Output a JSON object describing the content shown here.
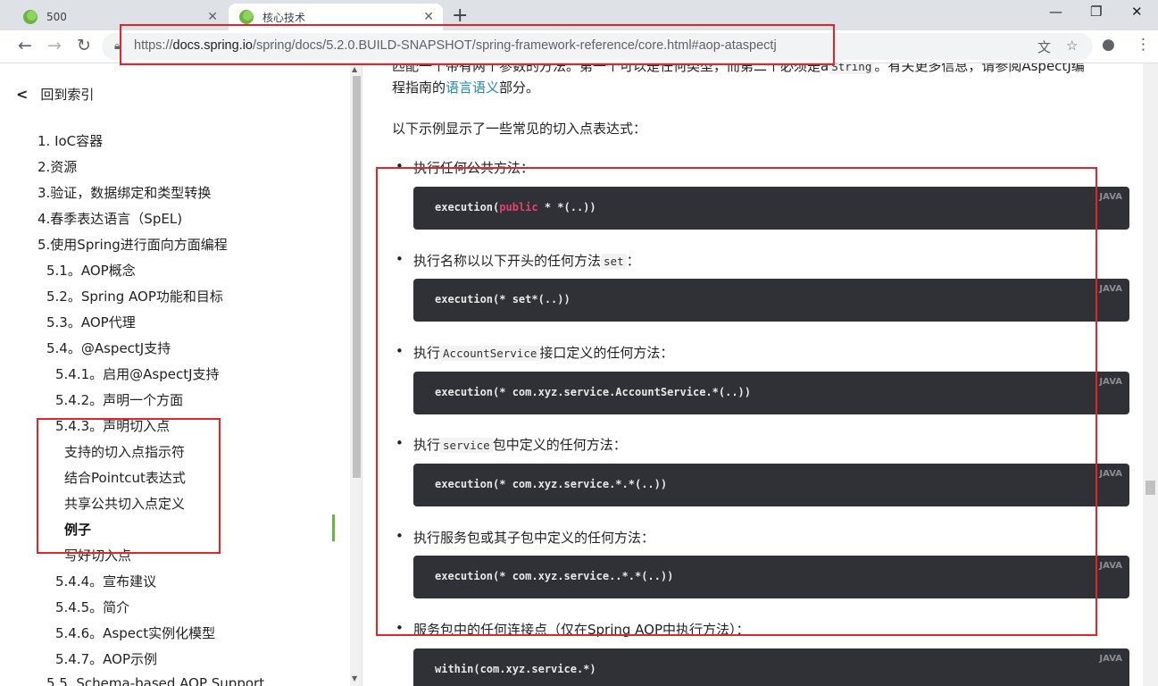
{
  "browser": {
    "tabs": [
      {
        "title": "500",
        "active": false
      },
      {
        "title": "核心技术",
        "active": true
      }
    ],
    "new_tab": "+",
    "window_controls": {
      "minimize": "—",
      "restore": "❐",
      "close": "✕"
    },
    "url_base": "https://",
    "url_host": "docs.spring.io",
    "url_path": "/spring/docs/5.2.0.BUILD-SNAPSHOT/spring-framework-reference/core.html#aop-ataspectj",
    "icons": [
      "back-icon",
      "forward-icon",
      "reload-icon",
      "lock-icon",
      "translate-icon",
      "star-icon",
      "account-icon",
      "menu-icon"
    ]
  },
  "sidebar": {
    "back_label": "回到索引",
    "items": [
      {
        "label": "1. IoC容器"
      },
      {
        "label": "2.资源"
      },
      {
        "label": "3.验证，数据绑定和类型转换"
      },
      {
        "label": "4.春季表达语言（SpEL)"
      },
      {
        "label": "5.使用Spring进行面向方面编程"
      },
      {
        "label": "5.1。AOP概念"
      },
      {
        "label": "5.2。Spring AOP功能和目标"
      },
      {
        "label": "5.3。AOP代理"
      },
      {
        "label": "5.4。@AspectJ支持"
      },
      {
        "label": "5.4.1。启用@AspectJ支持"
      },
      {
        "label": "5.4.2。声明一个方面"
      },
      {
        "label": "5.4.3。声明切入点"
      },
      {
        "label": "支持的切入点指示符"
      },
      {
        "label": "结合Pointcut表达式"
      },
      {
        "label": "共享公共切入点定义"
      },
      {
        "label": "例子"
      },
      {
        "label": "写好切入点"
      },
      {
        "label": "5.4.4。宣布建议"
      },
      {
        "label": "5.4.5。简介"
      },
      {
        "label": "5.4.6。Aspect实例化模型"
      },
      {
        "label": "5.4.7。AOP示例"
      },
      {
        "label": "5.5. Schema-based AOP Support"
      }
    ]
  },
  "content": {
    "intro_line1_a": "匹配一个带有两个参数的方法。第一个可以是任何类型，而第二个必须是a",
    "intro_line1_code": "String",
    "intro_line1_b": "。有关更多信息，请参阅AspectJ编",
    "intro_line2_a": "程指南的",
    "intro_line2_link": "语言语义",
    "intro_line2_b": "部分。",
    "examples_heading": "以下示例显示了一些常见的切入点表达式：",
    "code_lang": "JAVA",
    "examples": [
      {
        "pre": "执行任何公共方法：",
        "code_term": "",
        "post": "",
        "code_a": "execution(",
        "code_kw": "public",
        "code_b": " * *(..))"
      },
      {
        "pre": "执行名称以以下开头的任何方法",
        "code_term": "set",
        "post": "：",
        "code_a": "execution(* set*(..))",
        "code_kw": "",
        "code_b": ""
      },
      {
        "pre": "执行",
        "code_term": "AccountService",
        "post": "接口定义的任何方法：",
        "code_a": "execution(* com.xyz.service.AccountService.*(..))",
        "code_kw": "",
        "code_b": ""
      },
      {
        "pre": "执行",
        "code_term": "service",
        "post": "包中定义的任何方法：",
        "code_a": "execution(* com.xyz.service.*.*(..))",
        "code_kw": "",
        "code_b": ""
      },
      {
        "pre": "执行服务包或其子包中定义的任何方法：",
        "code_term": "",
        "post": "",
        "code_a": "execution(* com.xyz.service..*.*(..))",
        "code_kw": "",
        "code_b": ""
      },
      {
        "pre": "服务包中的任何连接点（仅在Spring AOP中执行方法）：",
        "code_term": "",
        "post": "",
        "code_a": "within(com.xyz.service.*)",
        "code_kw": "",
        "code_b": ""
      }
    ]
  },
  "colors": {
    "annotation": "#e0262b",
    "link": "#1e88c7",
    "code_bg": "#2f3136",
    "keyword": "#e3416b",
    "spring_green": "#6db33f"
  }
}
